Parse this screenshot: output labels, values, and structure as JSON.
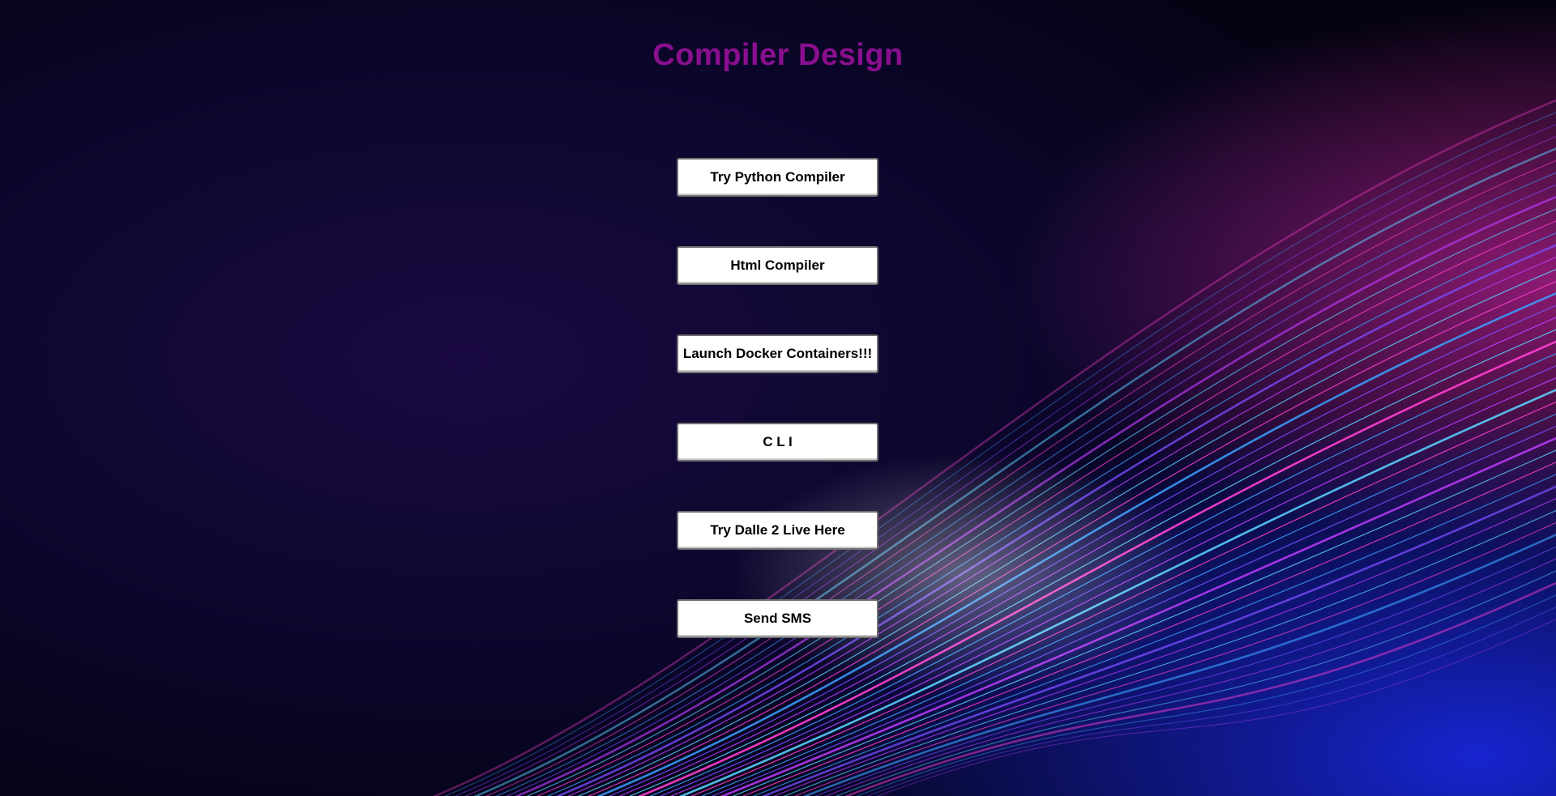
{
  "page": {
    "title": "Compiler Design"
  },
  "buttons": [
    {
      "label": "Try Python Compiler"
    },
    {
      "label": "Html Compiler"
    },
    {
      "label": "Launch Docker Containers!!!"
    },
    {
      "label": "C L I"
    },
    {
      "label": "Try Dalle 2 Live Here"
    },
    {
      "label": "Send SMS"
    }
  ],
  "colors": {
    "background": "#050318",
    "title": "#8a0f8e",
    "button_bg": "#ffffff",
    "button_text": "#000000",
    "wave_pink": "#ff3fd2",
    "wave_blue": "#3aa0ff",
    "wave_violet": "#7b4dff"
  }
}
